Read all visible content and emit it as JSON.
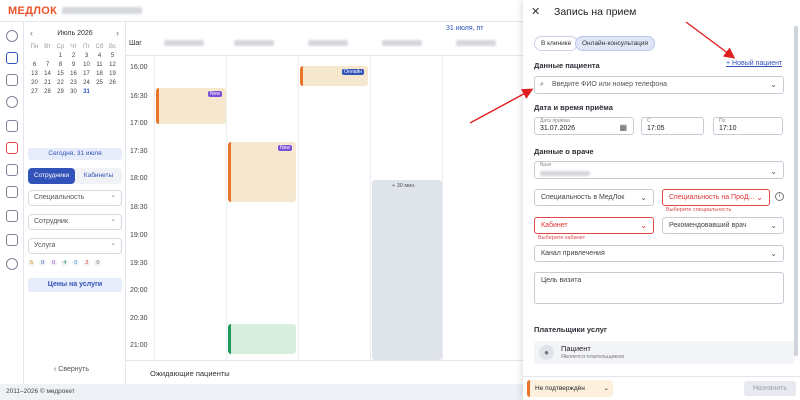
{
  "app": {
    "logo": "МЕДЛОК",
    "copyright": "2011–2026 © медрокет"
  },
  "calendar": {
    "month": "Июль 2026",
    "weekdays": [
      "Пн",
      "Вт",
      "Ср",
      "Чт",
      "Пт",
      "Сб",
      "Вс"
    ],
    "days": [
      "",
      "",
      "1",
      "2",
      "3",
      "4",
      "5",
      "6",
      "7",
      "8",
      "9",
      "10",
      "11",
      "12",
      "13",
      "14",
      "15",
      "16",
      "17",
      "18",
      "19",
      "20",
      "21",
      "22",
      "23",
      "24",
      "25",
      "26",
      "27",
      "28",
      "29",
      "30",
      "31"
    ],
    "today_label": "Сегодня, 31 июля"
  },
  "leftpanel": {
    "tabs": [
      "Сотрудники",
      "Кабинеты"
    ],
    "filters": [
      "Специальность",
      "Сотрудник",
      "Услуга"
    ],
    "counters": [
      "5",
      "0",
      "0",
      "4",
      "0",
      "2",
      "0"
    ],
    "prices_button": "Цены на услуги",
    "collapse": "Свернуть"
  },
  "schedule": {
    "step_label": "Шаг",
    "date_header": "31 июля, пт",
    "times": [
      "16:00",
      "16:30",
      "17:00",
      "17:30",
      "18:00",
      "18:30",
      "19:00",
      "19:30",
      "20:00",
      "20:30",
      "21:00"
    ],
    "badges": [
      "Онлайн",
      "New",
      "New"
    ],
    "plus_label": "+ 30 мин.",
    "waiting": "Ожидающие пациенты"
  },
  "drawer": {
    "title": "Запись на прием",
    "tabs": [
      "В клинике",
      "Онлайн-консультация"
    ],
    "patient_section": "Данные пациента",
    "new_patient": "Новый пациент",
    "search_placeholder": "Введите ФИО или номер телефона",
    "datetime_section": "Дата и время приёма",
    "date_label": "Дата приёма",
    "date_value": "31.07.2026",
    "from_label": "С",
    "from_value": "17:05",
    "to_label": "По",
    "to_value": "17:10",
    "doctor_section": "Данные о враче",
    "doctor_label": "Врач",
    "specialty_medlock": "Специальность в МедЛок",
    "specialty_prod": "Специальность на ПроД...",
    "specialty_error": "Выберите специальность",
    "cabinet": "Кабинет",
    "cabinet_error": "Выберите кабинет",
    "referring_doctor": "Рекомендовавший врач",
    "channel": "Канал привлечения",
    "visit_goal": "Цель визита",
    "payers_section": "Плательщики услуг",
    "payer_name": "Пациент",
    "payer_sub": "Является плательщиком",
    "status": "Не подтверждён",
    "assign_button": "Назначить"
  },
  "colors": {
    "accent": "#3152b8",
    "logo": "#e8542a",
    "error": "#e04848",
    "annotation_arrow": "#e02020"
  }
}
